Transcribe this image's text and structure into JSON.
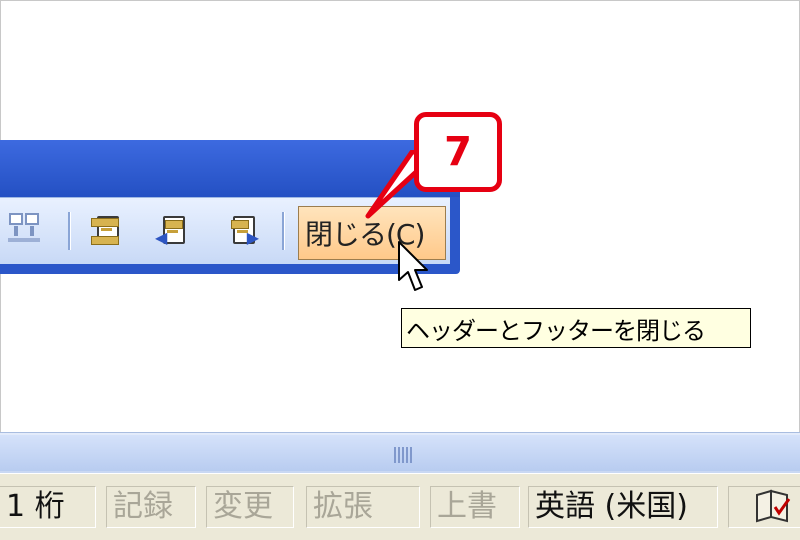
{
  "callout": {
    "number": "7"
  },
  "toolbar": {
    "close_label": "閉じる(C)",
    "icons": [
      "show-next-icon",
      "page-setup-icon",
      "show-previous-icon",
      "show-next-header-icon"
    ]
  },
  "tooltip": {
    "text": "ヘッダーとフッターを閉じる"
  },
  "statusbar": {
    "column": "1 桁",
    "record": "記録",
    "track_changes": "変更",
    "extend": "拡張",
    "overwrite": "上書",
    "language": "英語 (米国)"
  },
  "colors": {
    "callout_red": "#e60012",
    "toolbar_blue": "#2b57c9",
    "close_button_orange": "#ffc98a",
    "tooltip_bg": "#ffffe1"
  }
}
